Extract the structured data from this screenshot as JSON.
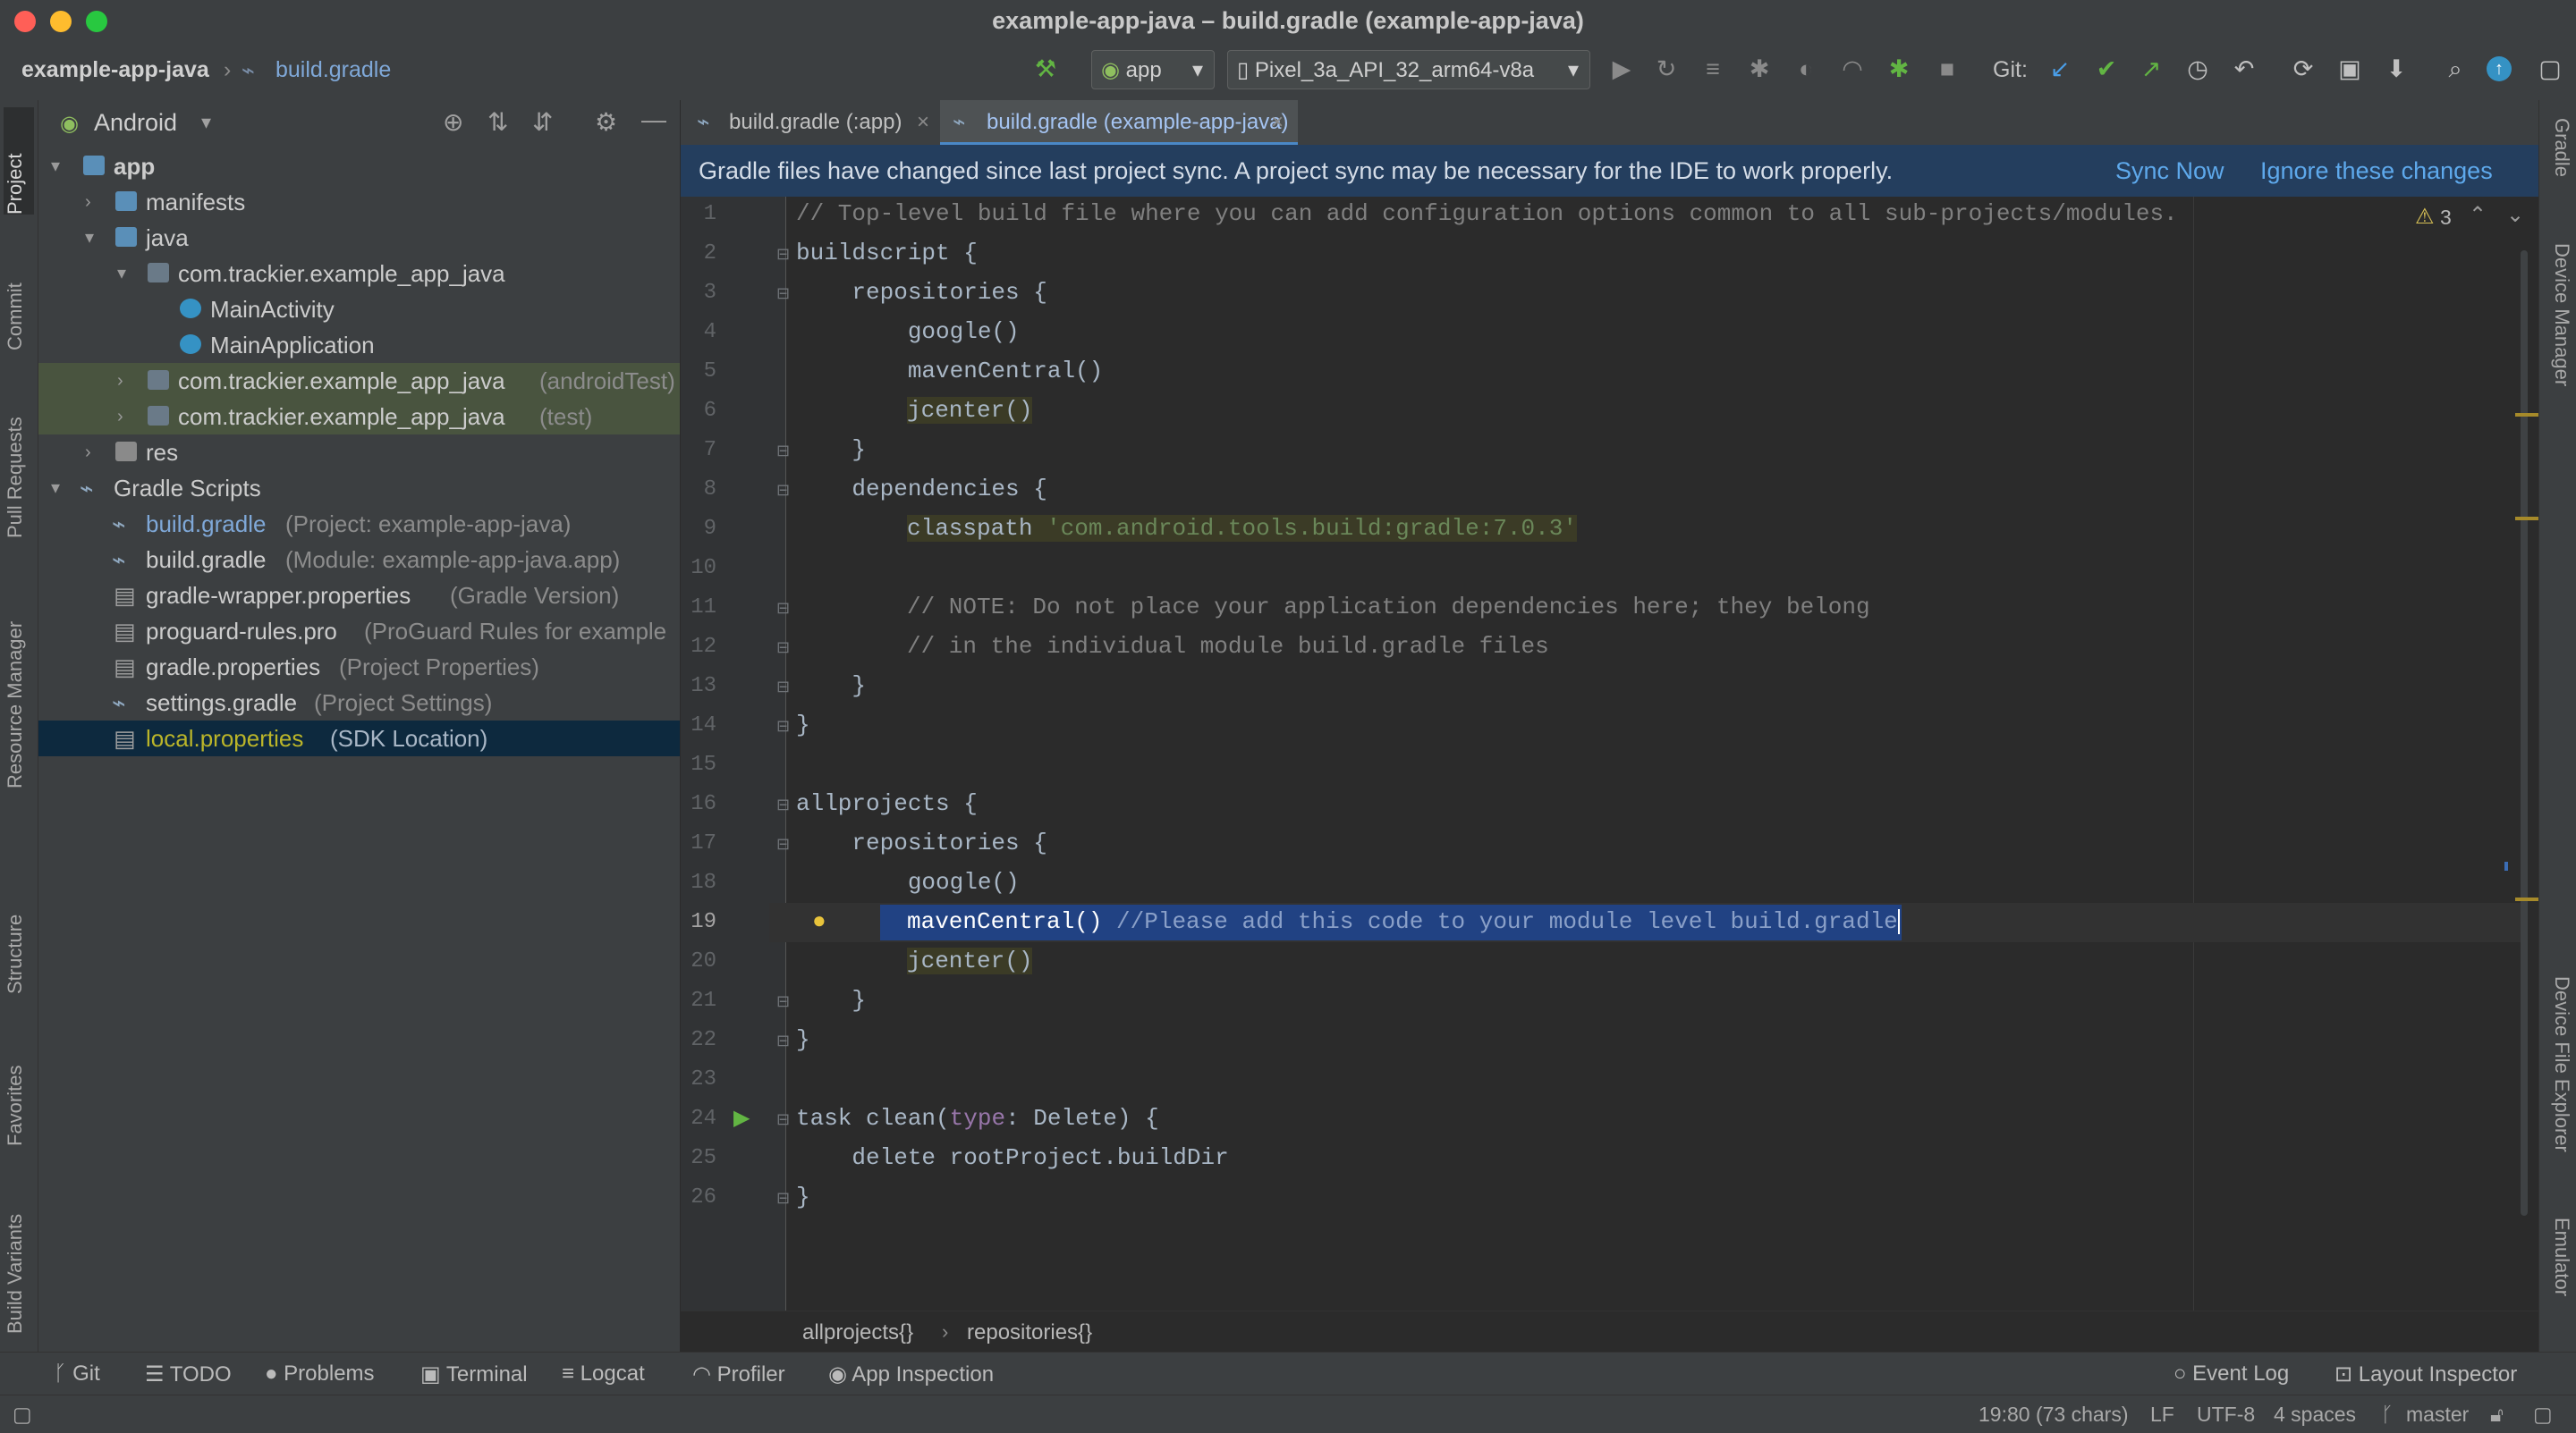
{
  "window": {
    "title": "example-app-java – build.gradle (example-app-java)"
  },
  "navbar": {
    "project": "example-app-java",
    "file": "build.gradle",
    "run_config": "app",
    "device": "Pixel_3a_API_32_arm64-v8a",
    "git_label": "Git:"
  },
  "left_tabs": [
    "Project",
    "Commit",
    "Pull Requests",
    "Resource Manager",
    "Structure",
    "Favorites",
    "Build Variants"
  ],
  "right_tabs": [
    "Gradle",
    "Device Manager",
    "Device File Explorer",
    "Emulator"
  ],
  "project_panel": {
    "view": "Android",
    "tree": [
      {
        "label": "app",
        "hint": ""
      },
      {
        "label": "manifests",
        "hint": ""
      },
      {
        "label": "java",
        "hint": ""
      },
      {
        "label": "com.trackier.example_app_java",
        "hint": ""
      },
      {
        "label": "MainActivity",
        "hint": ""
      },
      {
        "label": "MainApplication",
        "hint": ""
      },
      {
        "label": "com.trackier.example_app_java",
        "hint": "(androidTest)"
      },
      {
        "label": "com.trackier.example_app_java",
        "hint": "(test)"
      },
      {
        "label": "res",
        "hint": ""
      },
      {
        "label": "Gradle Scripts",
        "hint": ""
      },
      {
        "label": "build.gradle",
        "hint": "(Project: example-app-java)"
      },
      {
        "label": "build.gradle",
        "hint": "(Module: example-app-java.app)"
      },
      {
        "label": "gradle-wrapper.properties",
        "hint": "(Gradle Version)"
      },
      {
        "label": "proguard-rules.pro",
        "hint": "(ProGuard Rules for example"
      },
      {
        "label": "gradle.properties",
        "hint": "(Project Properties)"
      },
      {
        "label": "settings.gradle",
        "hint": "(Project Settings)"
      },
      {
        "label": "local.properties",
        "hint": "(SDK Location)"
      }
    ]
  },
  "tabs": [
    {
      "label": "build.gradle (:app)"
    },
    {
      "label": "build.gradle (example-app-java)"
    }
  ],
  "banner": {
    "text": "Gradle files have changed since last project sync. A project sync may be necessary for the IDE to work properly.",
    "sync": "Sync Now",
    "ignore": "Ignore these changes"
  },
  "editor": {
    "warnings": "3",
    "lines": {
      "l1": "// Top-level build file where you can add configuration options common to all sub-projects/modules.",
      "l2": "buildscript {",
      "l3": "    repositories {",
      "l4": "        google()",
      "l5": "        mavenCentral()",
      "l6": "jcenter()",
      "l7": "    }",
      "l8": "    dependencies {",
      "l9a": "classpath ",
      "l9b": "'com.android.tools.build:gradle:7.0.3'",
      "l11": "// NOTE: Do not place your application dependencies here; they belong",
      "l12": "// in the individual module build.gradle files",
      "l13": "    }",
      "l14": "}",
      "l16": "allprojects {",
      "l17": "    repositories {",
      "l18": "        google()",
      "l19a": "mavenCentral() ",
      "l19b": "//Please add this code to your module level build.gradle",
      "l20": "jcenter()",
      "l21": "    }",
      "l22": "}",
      "l24a": "task clean(",
      "l24b": "type",
      "l24c": ": Delete) {",
      "l25": "    delete rootProject.buildDir",
      "l26": "}"
    },
    "line_numbers": [
      "1",
      "2",
      "3",
      "4",
      "5",
      "6",
      "7",
      "8",
      "9",
      "10",
      "11",
      "12",
      "13",
      "14",
      "15",
      "16",
      "17",
      "18",
      "19",
      "20",
      "21",
      "22",
      "23",
      "24",
      "25",
      "26"
    ]
  },
  "breadcrumbs": [
    "allprojects{}",
    "repositories{}"
  ],
  "tool_windows": {
    "git": "Git",
    "todo": "TODO",
    "problems": "Problems",
    "terminal": "Terminal",
    "logcat": "Logcat",
    "profiler": "Profiler",
    "app_inspection": "App Inspection",
    "event_log": "Event Log",
    "layout_inspector": "Layout Inspector"
  },
  "status": {
    "position": "19:80 (73 chars)",
    "line_sep": "LF",
    "encoding": "UTF-8",
    "indent": "4 spaces",
    "branch": "master"
  }
}
